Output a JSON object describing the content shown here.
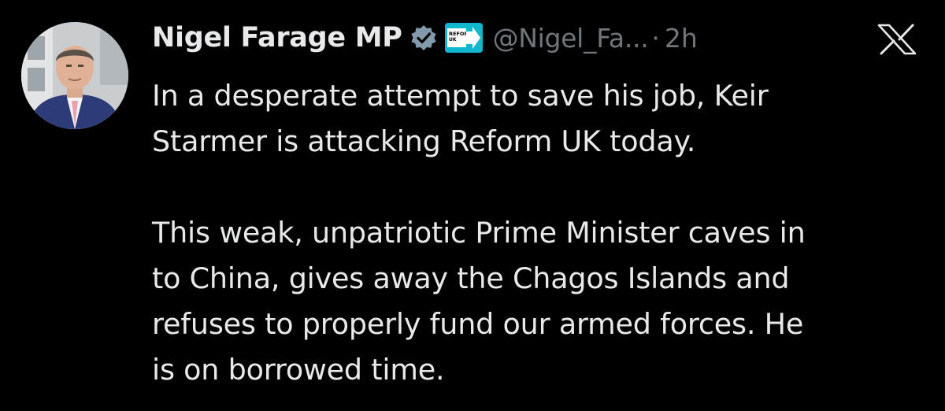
{
  "tweet": {
    "author_name": "Nigel Farage MP",
    "handle": "@Nigel_Fa...",
    "separator": "·",
    "time": "2h",
    "affiliation_badge_line1": "REFORM",
    "affiliation_badge_line2": "UK",
    "paragraph_1": [
      "In a desperate attempt to save his job, Keir",
      "Starmer is attacking Reform UK today."
    ],
    "paragraph_2": [
      "This weak, unpatriotic Prime Minister caves in",
      "to China, gives away the Chagos Islands and",
      "refuses to properly fund our armed forces. He",
      "is on borrowed time."
    ]
  },
  "icons": {
    "verified": "verified-badge-icon",
    "affiliation": "reform-uk-affiliate-icon",
    "platform": "x-logo-icon"
  },
  "colors": {
    "background": "#000000",
    "text": "#e7e9ea",
    "muted": "#71767b",
    "verified_badge": "#829aab",
    "reform_badge": "#12b6cf"
  }
}
